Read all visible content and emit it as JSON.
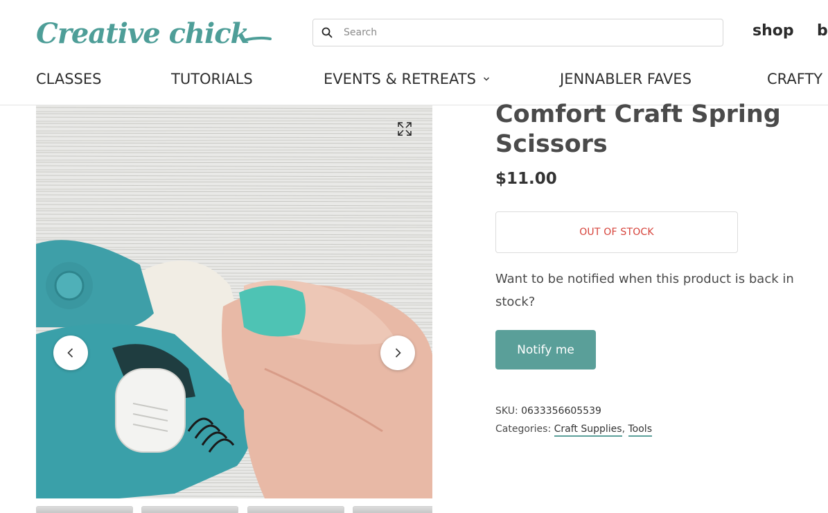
{
  "brand": {
    "logo_text": "Creative Chick",
    "accent_color": "#5a9f99",
    "logo_color": "#4e9e98"
  },
  "header": {
    "search_placeholder": "Search",
    "search_value": "",
    "links": [
      "shop",
      "b"
    ]
  },
  "nav": {
    "items": [
      "CLASSES",
      "TUTORIALS",
      "EVENTS & RETREATS",
      "JENNABLER FAVES",
      "CRAFTY"
    ]
  },
  "gallery": {
    "icons": {
      "expand": "expand-arrows-icon",
      "prev": "chevron-left-icon",
      "next": "chevron-right-icon"
    },
    "thumbnail_count": 4
  },
  "product": {
    "title": "Comfort Craft Spring Scissors",
    "price": "$11.00",
    "stock_status": "OUT OF STOCK",
    "stock_color": "#d6423a",
    "notify_prompt": "Want to be notified when this product is back in stock?",
    "notify_button": "Notify me",
    "sku_label": "SKU:",
    "sku": "0633356605539",
    "categories_label": "Categories:",
    "categories": [
      "Craft Supplies",
      "Tools"
    ]
  }
}
